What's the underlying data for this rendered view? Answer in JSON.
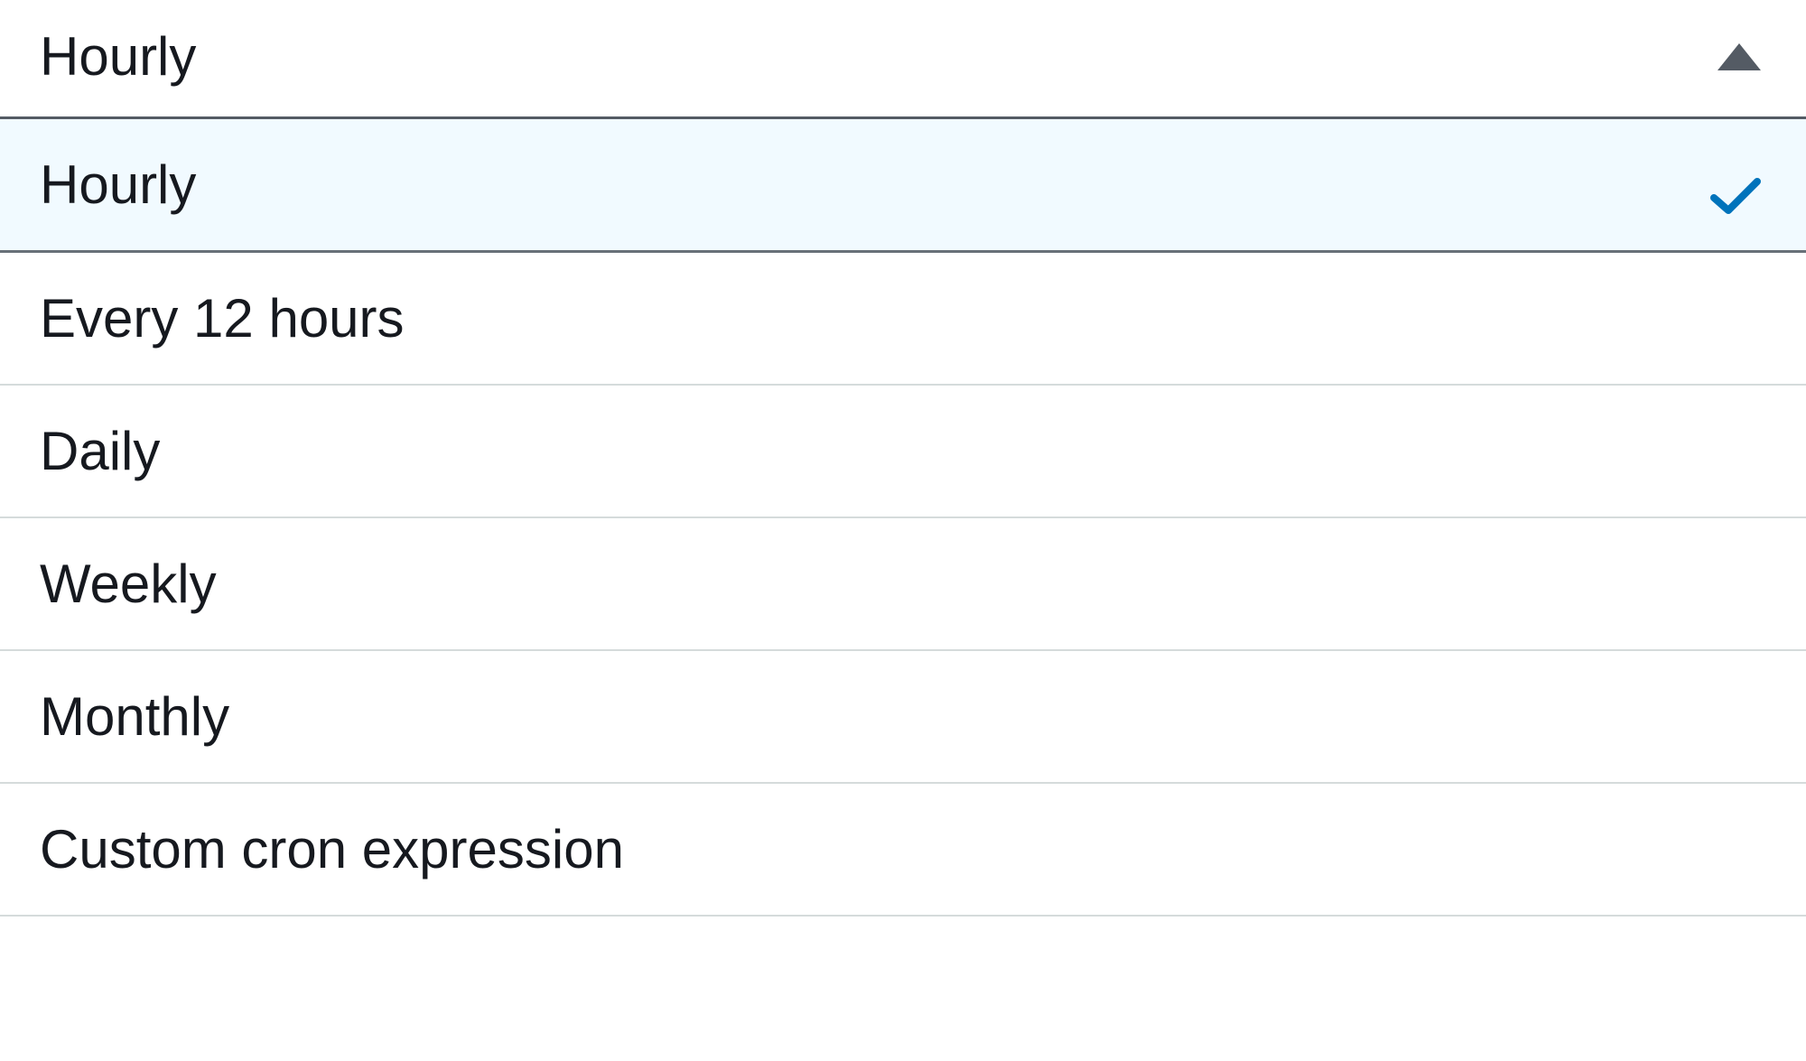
{
  "dropdown": {
    "selected_value": "Hourly",
    "selected_index": 0,
    "options": [
      {
        "label": "Hourly"
      },
      {
        "label": "Every 12 hours"
      },
      {
        "label": "Daily"
      },
      {
        "label": "Weekly"
      },
      {
        "label": "Monthly"
      },
      {
        "label": "Custom cron expression"
      }
    ]
  },
  "colors": {
    "text": "#16191f",
    "border_strong": "#545b64",
    "border_light": "#d5dbdb",
    "selected_bg": "#f1faff",
    "check_color": "#0073bb"
  }
}
